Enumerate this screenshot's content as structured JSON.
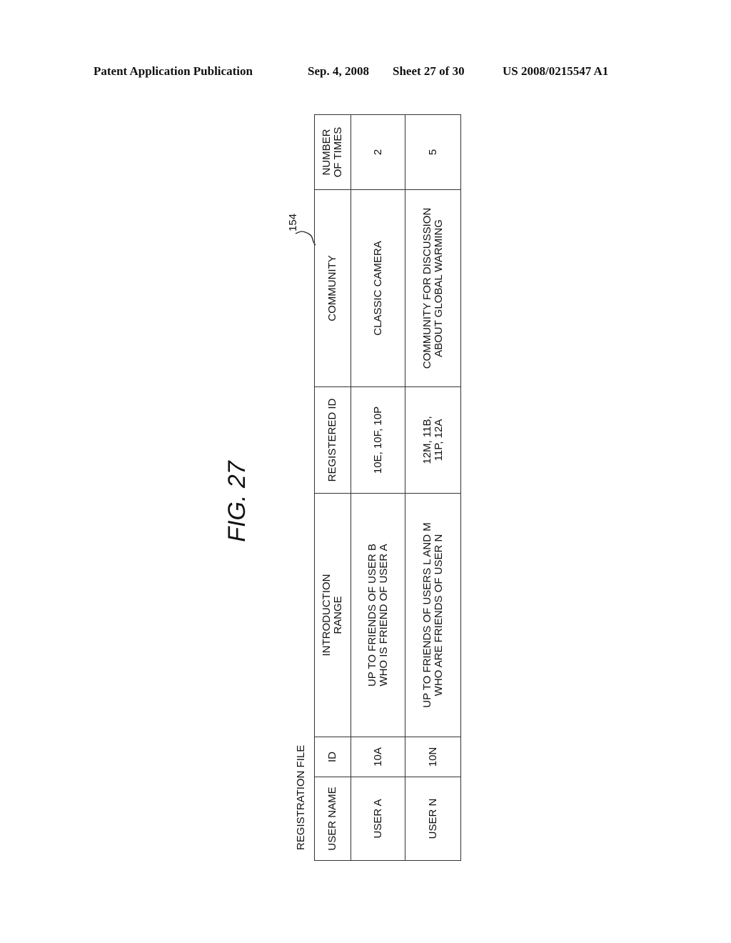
{
  "header": {
    "publication": "Patent Application Publication",
    "date": "Sep. 4, 2008",
    "sheet": "Sheet 27 of 30",
    "patent_number": "US 2008/0215547 A1"
  },
  "figure": {
    "title": "FIG. 27",
    "reference_numeral": "154",
    "table_title": "REGISTRATION FILE"
  },
  "table": {
    "columns": [
      "USER NAME",
      "ID",
      "INTRODUCTION\nRANGE",
      "REGISTERED ID",
      "COMMUNITY",
      "NUMBER\nOF TIMES"
    ],
    "rows": [
      [
        "USER A",
        "10A",
        "UP TO FRIENDS OF USER B\nWHO IS FRIEND OF USER A",
        "10E, 10F, 10P",
        "CLASSIC CAMERA",
        "2"
      ],
      [
        "USER N",
        "10N",
        "UP TO FRIENDS OF USERS L AND M\nWHO ARE FRIENDS OF USER N",
        "12M, 11B,\n11P, 12A",
        "COMMUNITY FOR DISCUSSION\nABOUT GLOBAL WARMING",
        "5"
      ]
    ]
  }
}
